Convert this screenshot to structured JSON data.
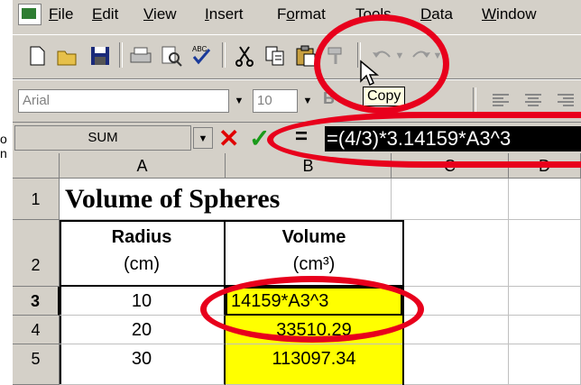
{
  "menubar": {
    "items": [
      {
        "label": "File",
        "u": "F",
        "rest": "ile"
      },
      {
        "label": "Edit",
        "u": "E",
        "rest": "dit"
      },
      {
        "label": "View",
        "u": "V",
        "rest": "iew"
      },
      {
        "label": "Insert",
        "u": "I",
        "rest": "nsert"
      },
      {
        "label": "Format",
        "pre": "F",
        "u": "o",
        "rest": "rmat"
      },
      {
        "label": "Tools",
        "u": "T",
        "rest": "ools"
      },
      {
        "label": "Data",
        "u": "D",
        "rest": "ata"
      },
      {
        "label": "Window",
        "u": "W",
        "rest": "indow"
      }
    ]
  },
  "format_toolbar": {
    "font_name": "Arial",
    "font_size": "10"
  },
  "tooltip": "Copy",
  "left_edge_text": [
    "o",
    "n"
  ],
  "formula_bar": {
    "name_box": "SUM",
    "equals": "=",
    "formula": "=(4/3)*3.14159*A3^3"
  },
  "columns": [
    "A",
    "B",
    "C",
    "D"
  ],
  "rows": [
    "1",
    "2",
    "3",
    "4",
    "5"
  ],
  "cells": {
    "title": "Volume of Spheres",
    "a2_line1": "Radius",
    "a2_line2": "(cm)",
    "b2_line1": "Volume",
    "b2_line2": "(cm³)",
    "a3": "10",
    "b3": "14159*A3^3",
    "a4": "20",
    "b4": "33510.29",
    "a5": "30",
    "b5": "113097.34"
  },
  "colors": {
    "highlight": "#ffff00",
    "annotation": "#e8001c",
    "chrome": "#d4d0c8"
  }
}
